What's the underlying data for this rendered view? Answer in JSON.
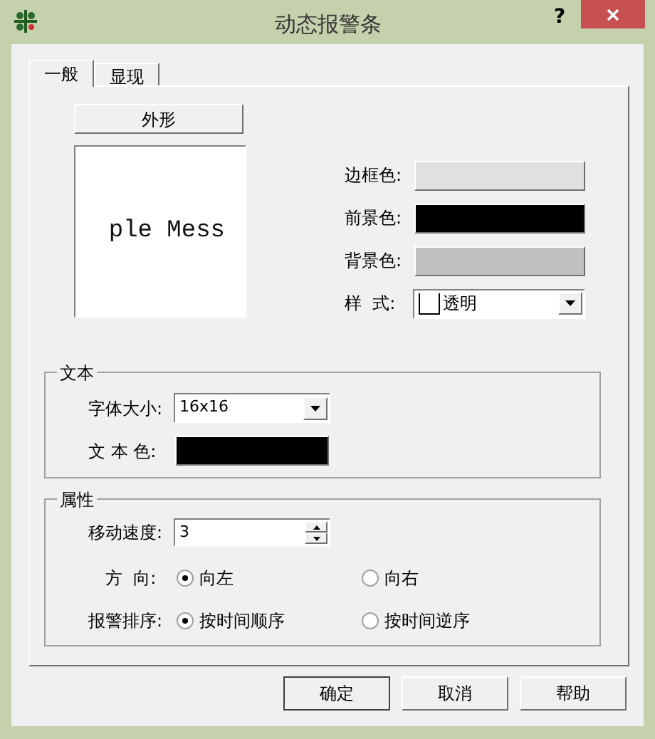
{
  "window": {
    "title": "动态报警条",
    "help": "?"
  },
  "tabs": [
    {
      "label": "一般",
      "selected": true
    },
    {
      "label": "显现",
      "selected": false
    }
  ],
  "appearance": {
    "button": "外形",
    "preview_text": "ple Mess"
  },
  "colors": [
    {
      "label": "边框色:",
      "color": "#e0e0e0"
    },
    {
      "label": "前景色:",
      "color": "#000000"
    },
    {
      "label": "背景色:",
      "color": "#c0c0c0"
    }
  ],
  "style": {
    "label": "样  式:",
    "value": "透明"
  },
  "text_group": {
    "title": "文本",
    "font_size_label": "字体大小:",
    "font_size": "16x16",
    "text_color_label": "文 本 色:",
    "text_color_swatch": {
      "color": "#000000"
    }
  },
  "props_group": {
    "title": "属性",
    "speed_label": "移动速度:",
    "speed": "3",
    "radio_rows": [
      {
        "label": "方  向:",
        "options": [
          {
            "label": "向左",
            "selected": true
          },
          {
            "label": "向右",
            "selected": false
          }
        ]
      },
      {
        "label": "报警排序:",
        "options": [
          {
            "label": "按时间顺序",
            "selected": true
          },
          {
            "label": "按时间逆序",
            "selected": false
          }
        ]
      }
    ]
  },
  "buttons": [
    "确定",
    "取消",
    "帮助"
  ]
}
